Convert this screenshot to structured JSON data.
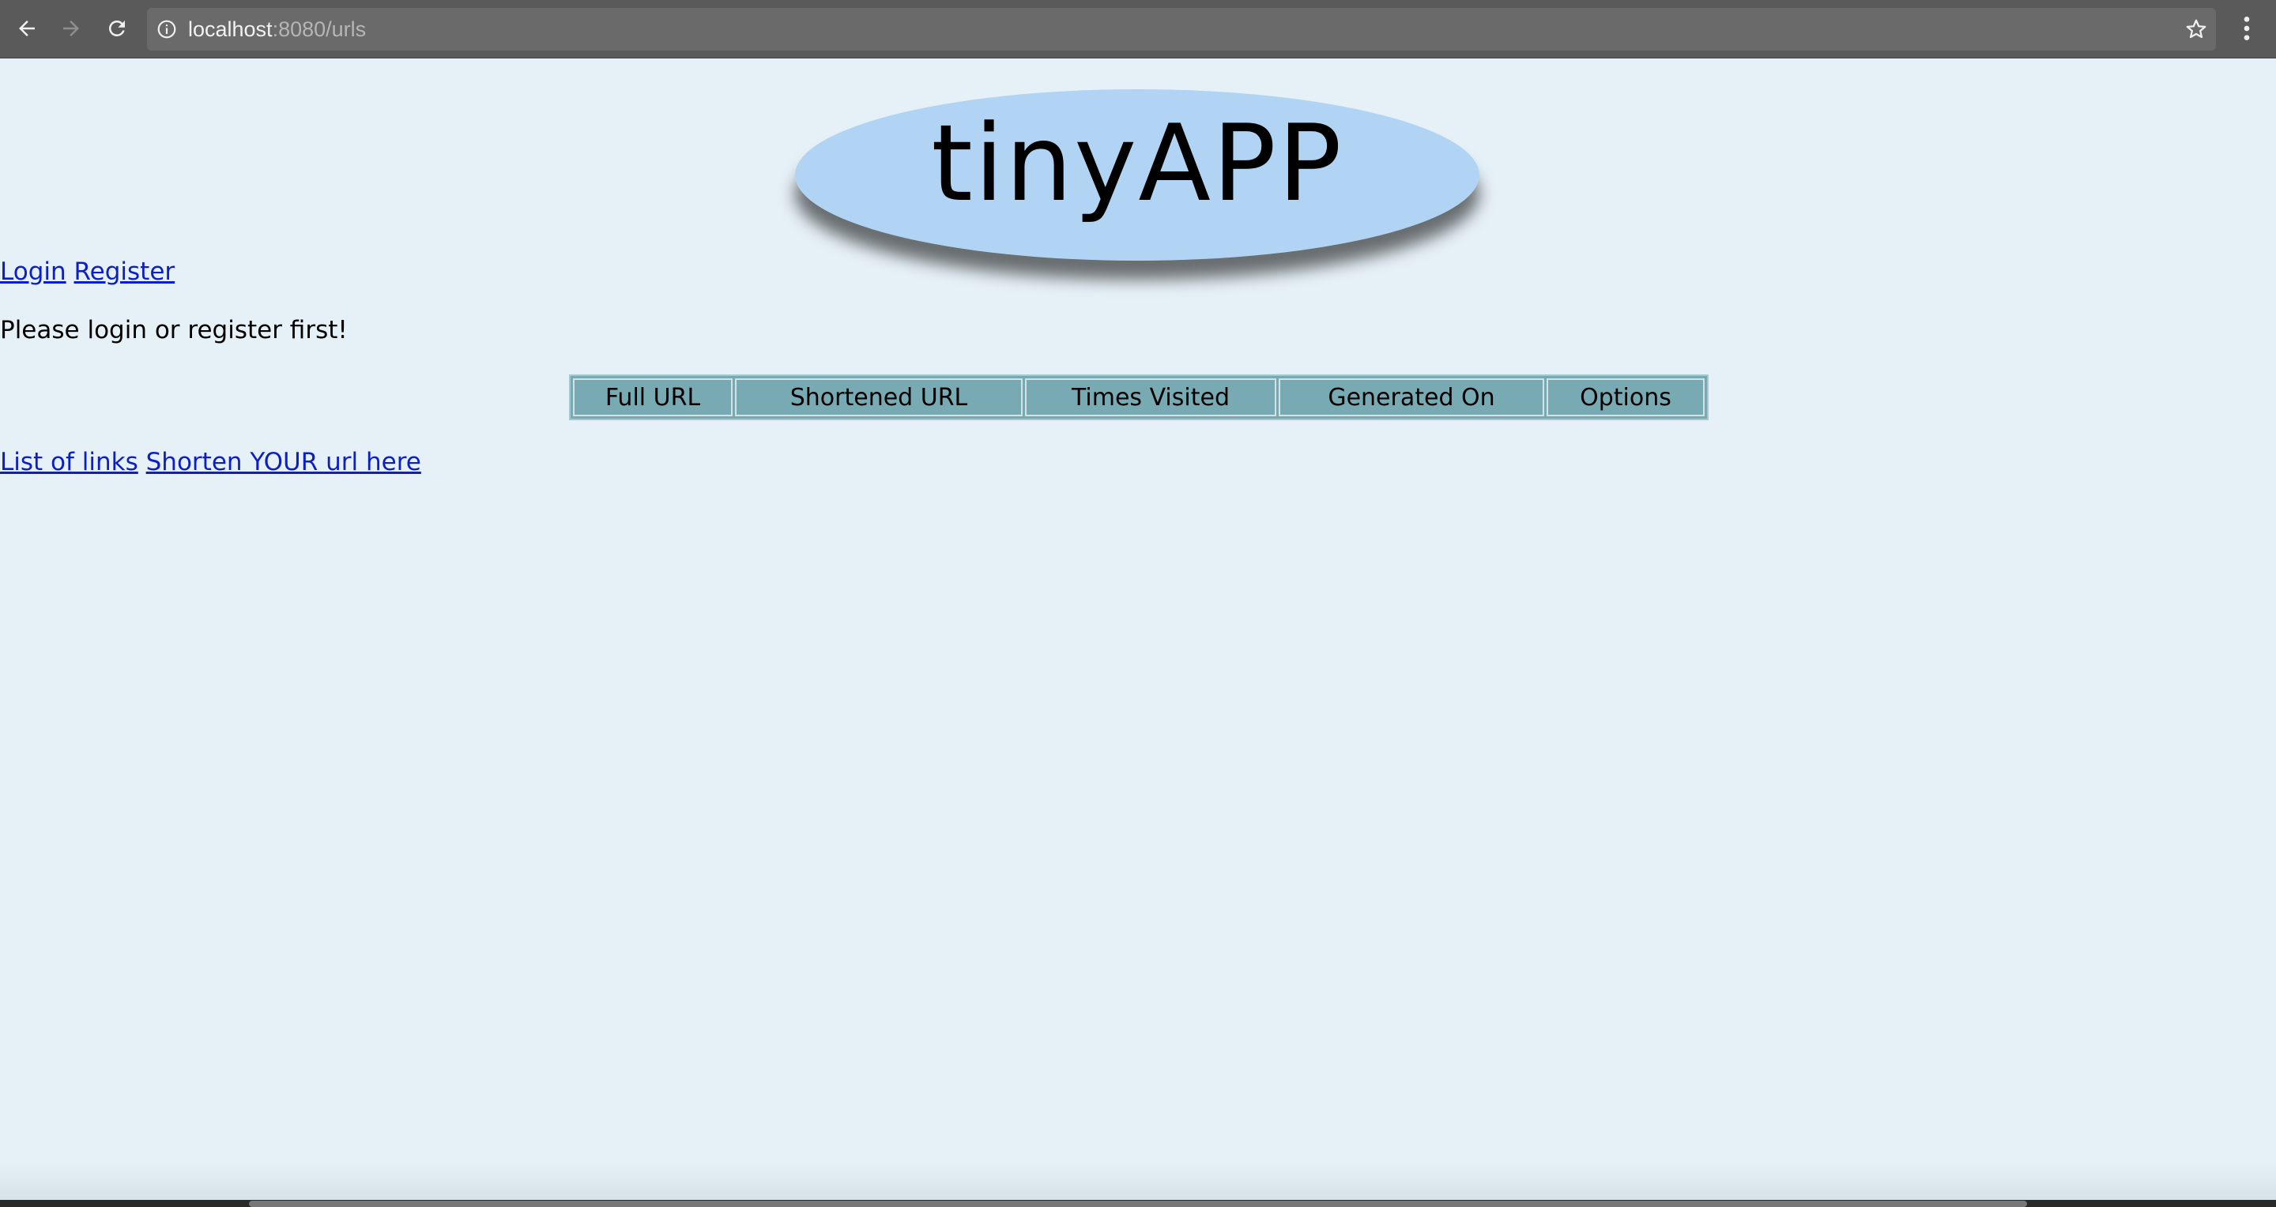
{
  "browser": {
    "url_host": "localhost",
    "url_rest": ":8080/urls",
    "icons": {
      "back": "back-arrow-icon",
      "forward": "forward-arrow-icon",
      "reload": "reload-icon",
      "info": "info-icon",
      "bookmark": "star-icon",
      "menu": "kebab-menu-icon"
    }
  },
  "header": {
    "logo_text": "tinyAPP",
    "logo_color": "#b2d4f4"
  },
  "auth": {
    "login_label": "Login",
    "register_label": "Register"
  },
  "notice": "Please login or register first!",
  "table": {
    "columns": [
      "Full URL",
      "Shortened URL",
      "Times Visited",
      "Generated On",
      "Options"
    ],
    "rows": []
  },
  "footer_links": {
    "list_label": "List of links",
    "shorten_label": "Shorten YOUR url here"
  },
  "colors": {
    "page_bg": "#e6f1f7",
    "link": "#0c1fc4",
    "table_header": "#78aab4"
  }
}
